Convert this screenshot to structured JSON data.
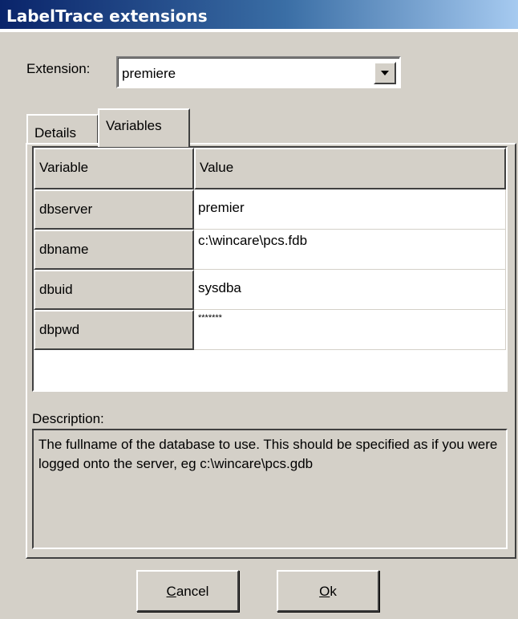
{
  "window": {
    "title": "LabelTrace extensions"
  },
  "extension": {
    "label": "Extension:",
    "selected": "premiere"
  },
  "tabs": [
    {
      "label": "Details",
      "active": false
    },
    {
      "label": "Variables",
      "active": true
    }
  ],
  "grid": {
    "columns": [
      "Variable",
      "Value"
    ],
    "rows": [
      {
        "variable": "dbserver",
        "value": "premier"
      },
      {
        "variable": "dbname",
        "value": "c:\\wincare\\pcs.fdb"
      },
      {
        "variable": "dbuid",
        "value": "sysdba"
      },
      {
        "variable": "dbpwd",
        "value": "*******"
      }
    ]
  },
  "description": {
    "label": "Description:",
    "text": "The fullname of the database to use. This should be specified as if you were logged onto the server, eg c:\\wincare\\pcs.gdb"
  },
  "buttons": {
    "cancel_first": "C",
    "cancel_rest": "ancel",
    "ok_first": "O",
    "ok_rest": "k"
  },
  "icons": {
    "dropdown": "chevron-down-icon"
  }
}
